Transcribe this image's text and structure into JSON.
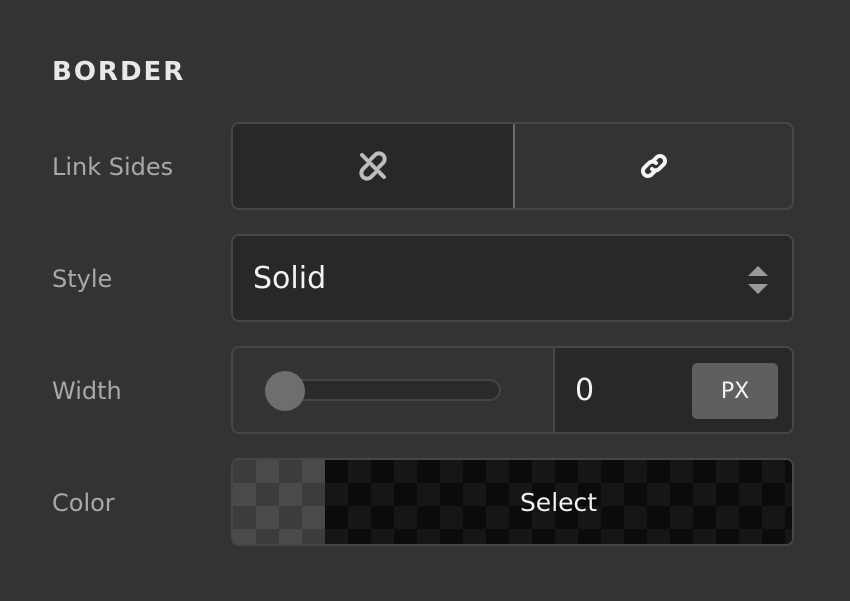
{
  "section": {
    "title": "BORDER"
  },
  "rows": {
    "link_sides": {
      "label": "Link Sides",
      "options": [
        {
          "icon": "unlink-icon",
          "selected": false
        },
        {
          "icon": "link-icon",
          "selected": true
        }
      ]
    },
    "style": {
      "label": "Style",
      "value": "Solid"
    },
    "width": {
      "label": "Width",
      "slider_fraction": 0,
      "value": "0",
      "unit": "PX"
    },
    "color": {
      "label": "Color",
      "button_label": "Select"
    }
  },
  "colors": {
    "background": "#333333",
    "control_bg": "#282828",
    "border": "#474747",
    "selected_border": "#6b6b6b",
    "text": "#f2f2f2",
    "label": "#a8a8a8"
  }
}
